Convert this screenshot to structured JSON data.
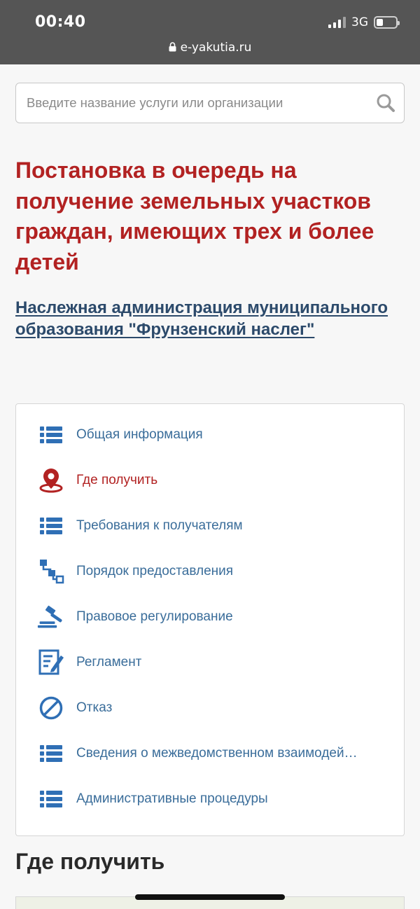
{
  "status_bar": {
    "time": "00:40",
    "network": "3G",
    "url": "e-yakutia.ru"
  },
  "search": {
    "placeholder": "Введите название услуги или организации",
    "value": ""
  },
  "service": {
    "title": "Постановка в очередь на получение земельных участков граждан, имеющих трех и более детей",
    "organization": "Наслежная администрация муниципального образования \"Фрунзенский наслег\""
  },
  "menu": {
    "items": [
      {
        "label": "Общая информация",
        "icon": "list-icon"
      },
      {
        "label": "Где получить",
        "icon": "location-pin-icon",
        "active": true
      },
      {
        "label": "Требования к получателям",
        "icon": "list-icon"
      },
      {
        "label": "Порядок предоставления",
        "icon": "flowchart-icon"
      },
      {
        "label": "Правовое регулирование",
        "icon": "gavel-icon"
      },
      {
        "label": "Регламент",
        "icon": "document-edit-icon"
      },
      {
        "label": "Отказ",
        "icon": "prohibited-icon"
      },
      {
        "label": "Сведения о межведомственном взаимодей…",
        "icon": "list-icon"
      },
      {
        "label": "Административные процедуры",
        "icon": "list-icon"
      }
    ]
  },
  "section": {
    "title": "Где получить"
  },
  "colors": {
    "accent_red": "#b22222",
    "link_blue": "#3a6d9a",
    "icon_blue": "#2f6fb5"
  }
}
